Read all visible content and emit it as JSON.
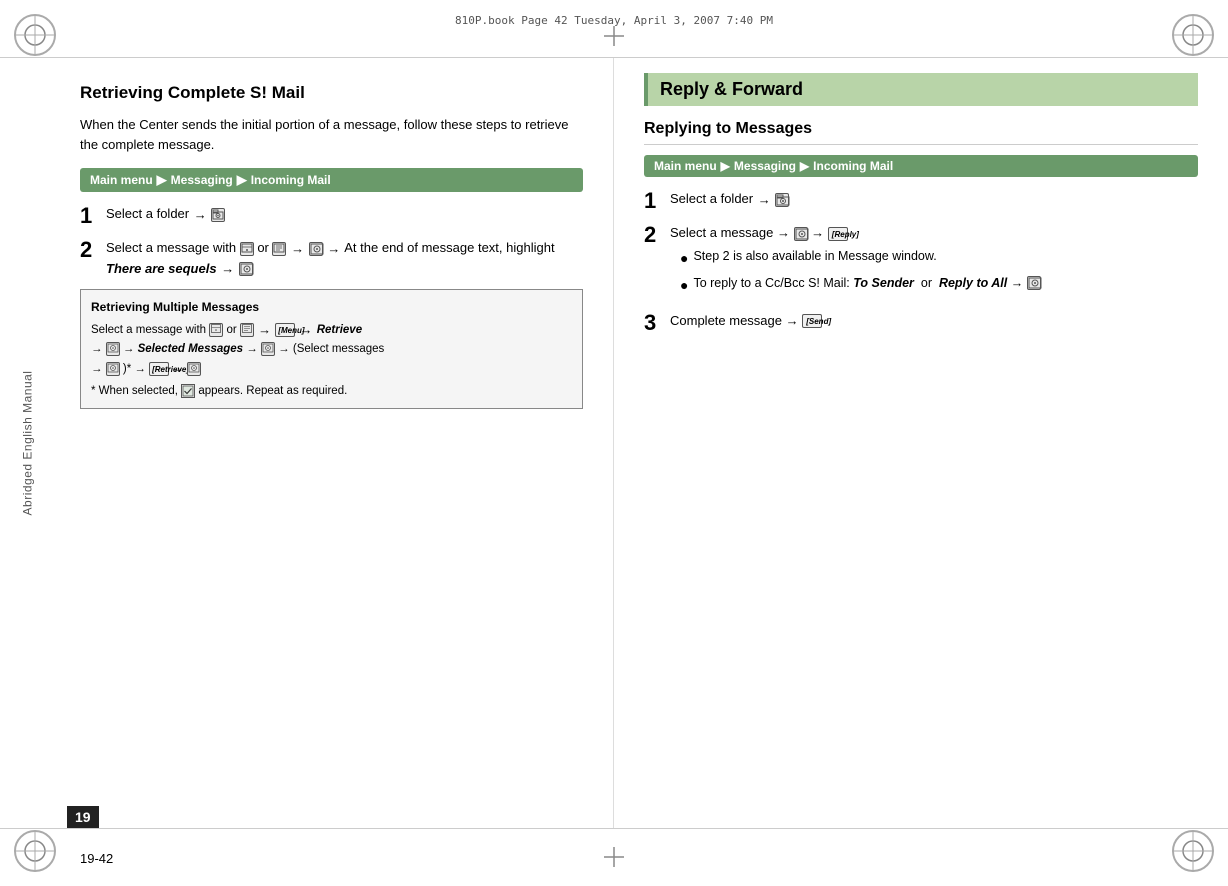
{
  "page": {
    "book_info": "810P.book  Page 42  Tuesday, April 3, 2007  7:40 PM",
    "sidebar_label": "Abridged English Manual",
    "page_number": "19",
    "bottom_page_number": "19-42"
  },
  "left_section": {
    "title": "Retrieving Complete S! Mail",
    "intro": "When the Center sends the initial portion of a message, follow these steps to retrieve the complete message.",
    "nav_bar": {
      "main_menu": "Main menu",
      "arrow1": "▶",
      "messaging": "Messaging",
      "arrow2": "▶",
      "incoming": "Incoming Mail"
    },
    "steps": [
      {
        "number": "1",
        "text": "Select a folder →"
      },
      {
        "number": "2",
        "text_before": "Select a message with",
        "or_text": "or",
        "text_after": "→ At the end of message text, highlight",
        "bold_italic": "There are sequels",
        "arrow_end": "→"
      }
    ],
    "info_box": {
      "title": "Retrieving Multiple Messages",
      "line1_before": "Select a message with",
      "line1_or": "or",
      "line1_after": "[Menu] → Retrieve",
      "line2": "→ Selected Messages →",
      "line2_after": "→ (Select messages",
      "line3": "→",
      "line3_star": ")*",
      "line3_after": "[Retrieve] →",
      "footnote": "* When selected,",
      "footnote_after": "appears. Repeat as required."
    }
  },
  "right_section": {
    "heading": "Reply & Forward",
    "sub_heading": "Replying to Messages",
    "nav_bar": {
      "main_menu": "Main menu",
      "arrow1": "▶",
      "messaging": "Messaging",
      "arrow2": "▶",
      "incoming": "Incoming Mail"
    },
    "steps": [
      {
        "number": "1",
        "text": "Select a folder →"
      },
      {
        "number": "2",
        "text_before": "Select a message →",
        "text_after": "[Reply]",
        "bullets": [
          "Step 2 is also available in Message window.",
          "To reply to a Cc/Bcc S! Mail: To Sender  or  Reply to All →"
        ]
      },
      {
        "number": "3",
        "text_before": "Complete message →",
        "text_after": "[Send]"
      }
    ]
  }
}
